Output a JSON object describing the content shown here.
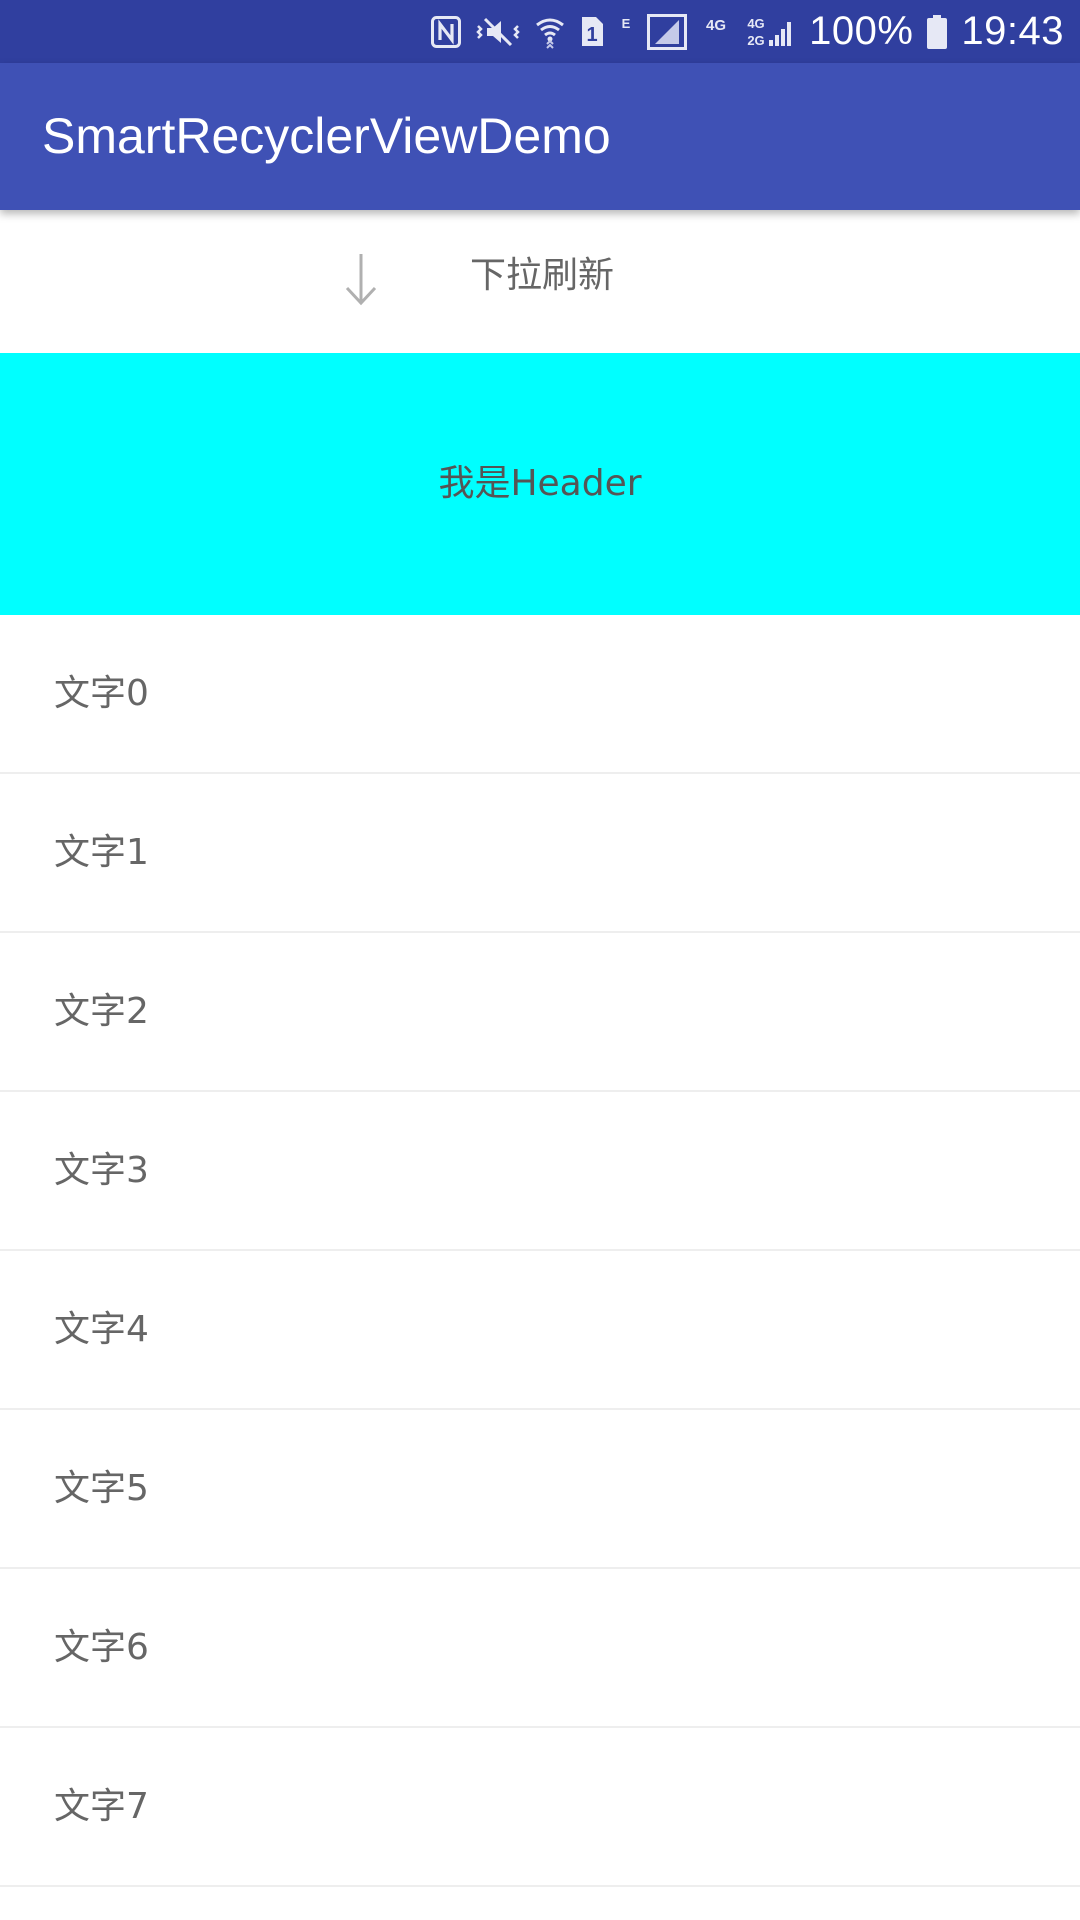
{
  "status_bar": {
    "battery_percent": "100%",
    "time": "19:43",
    "sim_badge": "1",
    "network_e": "E",
    "network_4g": "4G",
    "network_4g_2g_top": "4G",
    "network_4g_2g_bottom": "2G",
    "icons": [
      "nfc-icon",
      "vibrate-mute-icon",
      "wifi-icon",
      "sim1-icon",
      "signal-icon",
      "signal-icon-2",
      "battery-icon"
    ]
  },
  "app_bar": {
    "title": "SmartRecyclerViewDemo",
    "background": "#3f51b5",
    "status_background": "#303f9f"
  },
  "refresh": {
    "label": "下拉刷新",
    "icon": "arrow-down-icon"
  },
  "header": {
    "label": "我是Header",
    "background": "#00ffff"
  },
  "list": {
    "items": [
      {
        "label": "文字0"
      },
      {
        "label": "文字1"
      },
      {
        "label": "文字2"
      },
      {
        "label": "文字3"
      },
      {
        "label": "文字4"
      },
      {
        "label": "文字5"
      },
      {
        "label": "文字6"
      },
      {
        "label": "文字7"
      }
    ]
  }
}
